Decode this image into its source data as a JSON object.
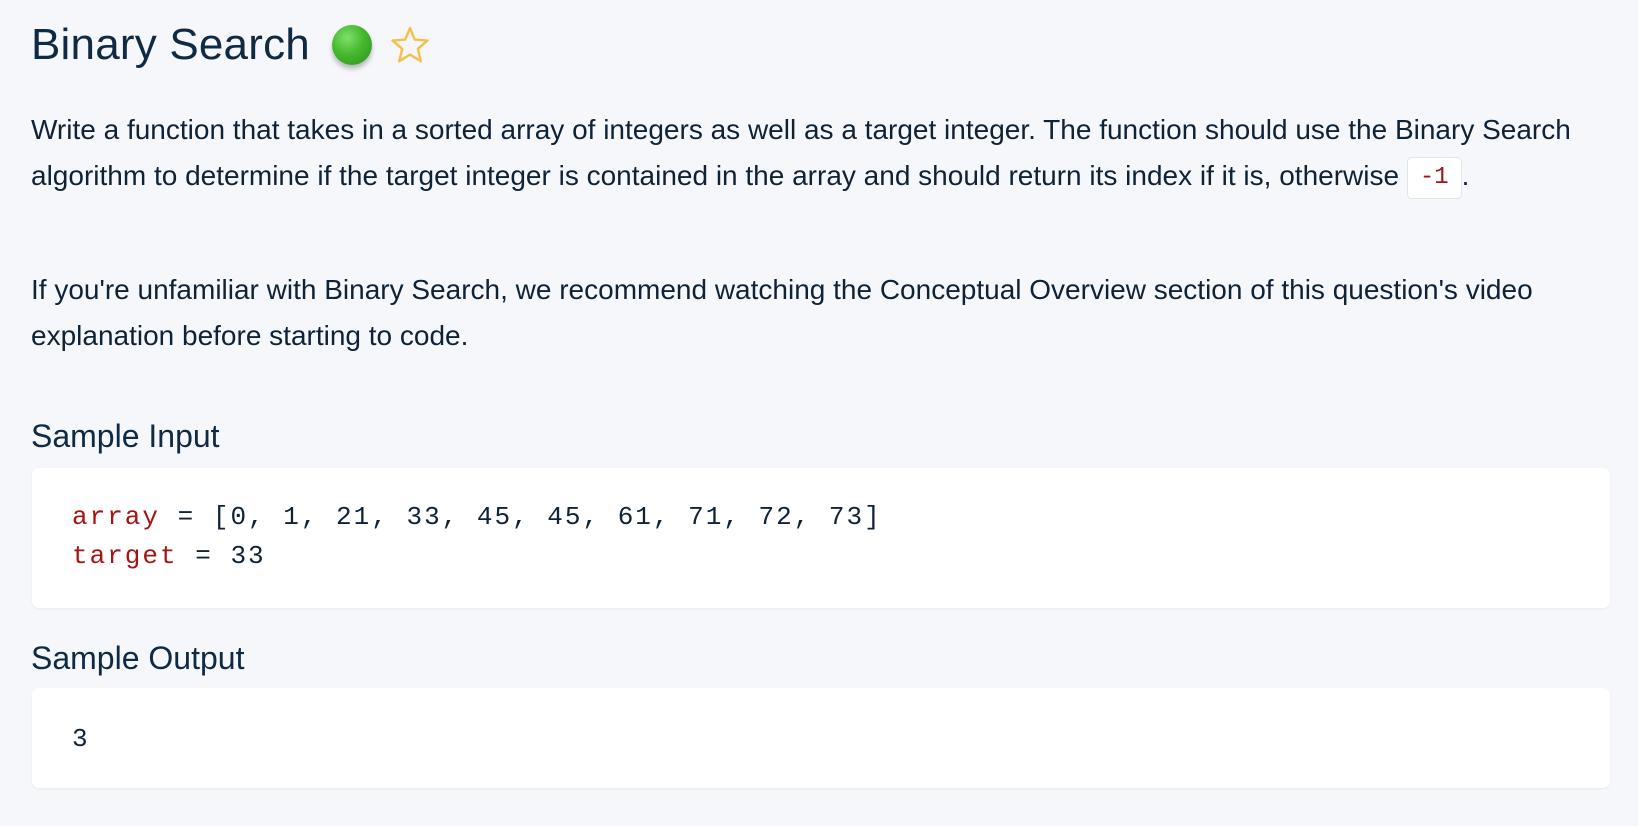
{
  "problem": {
    "title": "Binary Search",
    "difficulty_color": "#46b82f",
    "favorite_icon": "star-outline-icon",
    "favorite_color": "#f5c04a"
  },
  "description": {
    "paragraph1_text": "Write a function that takes in a sorted array of integers as well as a target integer. The function should use the Binary Search algorithm to determine if the target integer is contained in the array and should return its index if it is, otherwise ",
    "paragraph1_code": "-1",
    "paragraph1_end": ".",
    "paragraph2": "If you're unfamiliar with Binary Search, we recommend watching the Conceptual Overview section of this question's video explanation before starting to code."
  },
  "sample_input": {
    "heading": "Sample Input",
    "array_name": "array",
    "array_value": "[0, 1, 21, 33, 45, 45, 61, 71, 72, 73]",
    "target_name": "target",
    "target_value": "33",
    "operator": "="
  },
  "sample_output": {
    "heading": "Sample Output",
    "value": "3"
  }
}
